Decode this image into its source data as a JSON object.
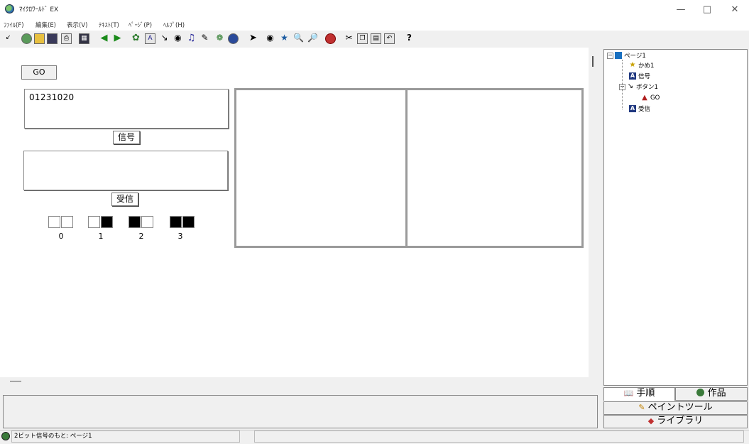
{
  "window": {
    "title": "ﾏｲｸﾛﾜｰﾙﾄﾞ EX"
  },
  "menu": [
    "ﾌｧｲﾙ(F)",
    "編集(E)",
    "表示(V)",
    "ﾃｷｽﾄ(T)",
    "ﾍﾟｰｼﾞ(P)",
    "ﾍﾙﾌﾟ(H)"
  ],
  "canvas": {
    "go_label": "GO",
    "signal_value": "01231020",
    "signal_label": "信号",
    "recv_value": "",
    "recv_label": "受信",
    "bits": [
      {
        "num": "0",
        "pattern": [
          0,
          0
        ]
      },
      {
        "num": "1",
        "pattern": [
          0,
          1
        ]
      },
      {
        "num": "2",
        "pattern": [
          1,
          0
        ]
      },
      {
        "num": "3",
        "pattern": [
          1,
          1
        ]
      }
    ]
  },
  "tree": {
    "root": "ページ1",
    "items": [
      {
        "label": "かめ1",
        "icon": "turtle-icon"
      },
      {
        "label": "信号",
        "icon": "text-icon"
      },
      {
        "label": "ボタン1",
        "icon": "button-icon"
      },
      {
        "label": "GO",
        "icon": "script-icon"
      },
      {
        "label": "受信",
        "icon": "text-icon"
      }
    ]
  },
  "tabs": {
    "procedure": "手順",
    "work": "作品",
    "paint_tool": "ペイントツール",
    "library": "ライブラリ"
  },
  "status": {
    "text": "2ビット信号のもと: ページ1"
  },
  "colors": {
    "frame": "#9a9a9a",
    "bit_on": "#000000",
    "bit_off": "#ffffff"
  }
}
